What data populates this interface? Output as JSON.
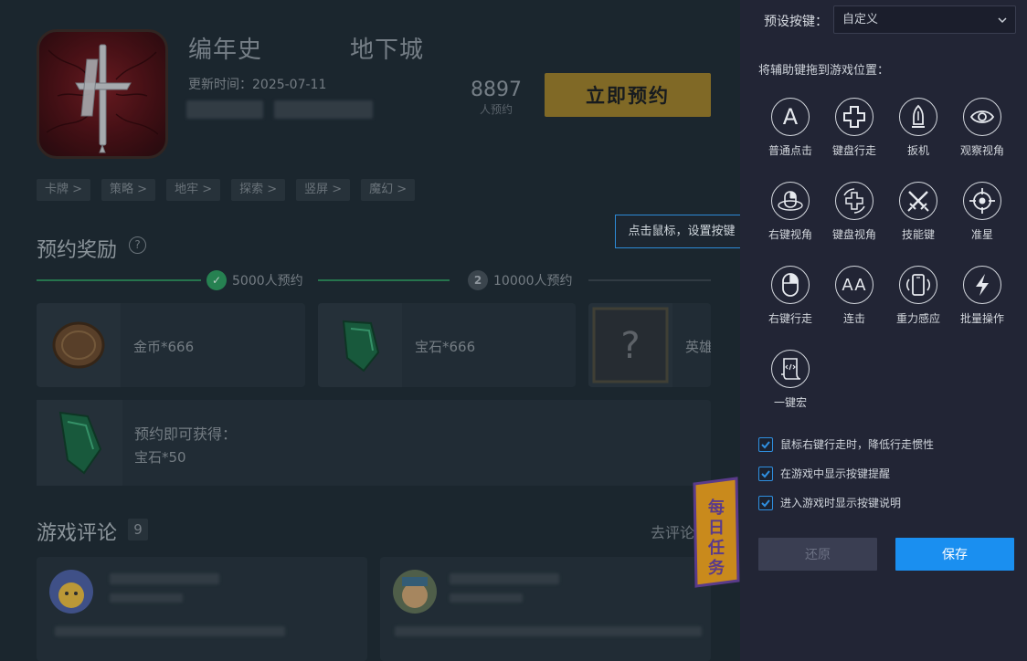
{
  "game": {
    "title_part1": "编年史",
    "title_part2": "地下城",
    "update_time": "更新时间：2025-07-11",
    "reserve_count": "8897",
    "reserve_count_label": "人预约",
    "reserve_button": "立即预约",
    "tags": [
      "卡牌 >",
      "策略 >",
      "地牢 >",
      "探索 >",
      "竖屏 >",
      "魔幻 >"
    ]
  },
  "rewards": {
    "title": "预约奖励",
    "help_icon": "?",
    "milestone1_num": "✓",
    "milestone1": "5000人预约",
    "milestone2_num": "2",
    "milestone2": "10000人预约",
    "items": [
      {
        "label": "金币*666"
      },
      {
        "label": "宝石*666"
      },
      {
        "label": "英雄"
      }
    ],
    "gain_title": "预约即可获得：",
    "gain_item": "宝石*50"
  },
  "reviews": {
    "title": "游戏评论",
    "count": "9",
    "link": "去评论"
  },
  "daily_badge": "每日任务",
  "tooltip": "点击鼠标，设置按键",
  "panel": {
    "preset_label": "预设按键：",
    "preset_value": "自定义",
    "drag_hint": "将辅助键拖到游戏位置：",
    "keys": [
      {
        "label": "普通点击",
        "icon": "letter-a-icon",
        "glyph": "A"
      },
      {
        "label": "键盘行走",
        "icon": "dpad-icon"
      },
      {
        "label": "扳机",
        "icon": "bullet-icon"
      },
      {
        "label": "观察视角",
        "icon": "eye-icon"
      },
      {
        "label": "右键视角",
        "icon": "mouse-orbit-icon"
      },
      {
        "label": "键盘视角",
        "icon": "keyboard-orbit-icon"
      },
      {
        "label": "技能键",
        "icon": "crossed-swords-icon"
      },
      {
        "label": "准星",
        "icon": "crosshair-icon"
      },
      {
        "label": "右键行走",
        "icon": "mouse-icon"
      },
      {
        "label": "连击",
        "icon": "double-a-icon",
        "glyph": "AA"
      },
      {
        "label": "重力感应",
        "icon": "phone-gravity-icon"
      },
      {
        "label": "批量操作",
        "icon": "lightning-icon"
      },
      {
        "label": "一键宏",
        "icon": "macro-icon"
      }
    ],
    "options": [
      "鼠标右键行走时，降低行走惯性",
      "在游戏中显示按键提醒",
      "进入游戏时显示按键说明"
    ],
    "restore_button": "还原",
    "save_button": "保存"
  },
  "colors": {
    "accent": "#1a8ff0",
    "reserve_gold": "#9a7d2a",
    "progress_green": "#2d9a5f",
    "panel_bg": "#222535"
  }
}
